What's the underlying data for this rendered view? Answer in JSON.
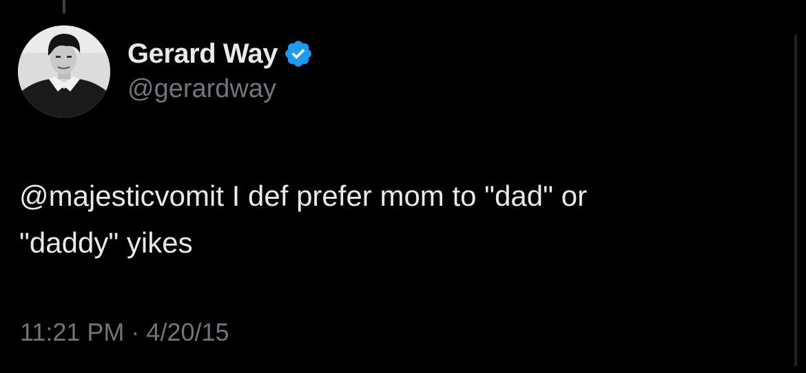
{
  "author": {
    "display_name": "Gerard Way",
    "handle": "@gerardway",
    "verified": true,
    "verified_color": "#1d9bf0"
  },
  "tweet": {
    "text_line1": "@majesticvomit I def prefer mom to \"dad\" or",
    "text_line2": "\"daddy\" yikes",
    "time": "11:21 PM",
    "separator": "·",
    "date": "4/20/15"
  },
  "icons": {
    "avatar": "profile-photo",
    "verified": "verified-badge-icon"
  },
  "colors": {
    "background": "#000000",
    "text_primary": "#e7e9ea",
    "text_secondary": "#71767b"
  }
}
